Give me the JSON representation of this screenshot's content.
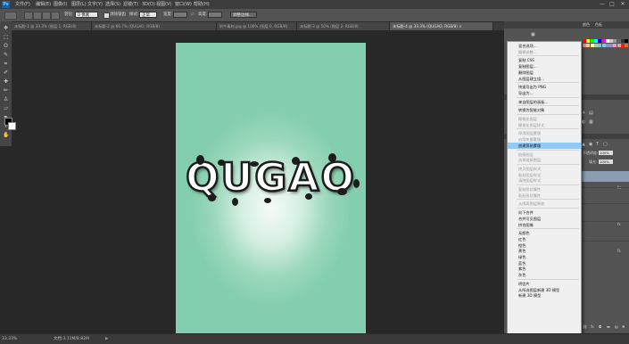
{
  "app": {
    "logo": "Ps"
  },
  "menubar": {
    "items": [
      "文件(F)",
      "编辑(E)",
      "图像(I)",
      "图层(L)",
      "文字(Y)",
      "选择(S)",
      "滤镜(T)",
      "3D(D)",
      "视图(V)",
      "窗口(W)",
      "帮助(H)"
    ],
    "window_controls": [
      "—",
      "□",
      "✕"
    ]
  },
  "options_bar": {
    "feather_label": "羽化:",
    "feather_value": "0 像素",
    "antialias_label": "消除锯齿",
    "style_label": "样式:",
    "style_value": "正常",
    "width_label": "宽度:",
    "height_label": "高度:",
    "refine_button": "调整边缘..."
  },
  "document_tabs": [
    "未标题-1 @ 33.3% (图层 1, RGB/8)",
    "未标题-2 @ 66.7% (QUGAO, RGB/8)",
    "奶牛素材.jpg @ 100% (图层 0, RGB/8)",
    "未标题-3 @ 50% (图层 2, RGB/8)",
    "未标题-4 @ 33.3% (QUGAO, RGB/8) ×"
  ],
  "canvas": {
    "art_text": "QUGAO",
    "background_colors": [
      "#83ceae",
      "#f6fbf8"
    ]
  },
  "statusbar": {
    "zoom": "33.33%",
    "doc_info": "文档:3.11M/8.82M"
  },
  "right_panel": {
    "tabs": [
      "颜色",
      "色板"
    ],
    "swatch_colors": [
      "#ff0000",
      "#ffff00",
      "#00ff00",
      "#00ffff",
      "#0000ff",
      "#ff00ff",
      "#ffffff",
      "#cccccc",
      "#999999",
      "#666666",
      "#333333",
      "#000000",
      "#f7977a",
      "#fdc68a",
      "#fff79a",
      "#a3d39c",
      "#7accc8",
      "#6dcff6",
      "#8393ca",
      "#a187be",
      "#f49ac2",
      "#c7b299",
      "#ed1c24",
      "#f26522"
    ],
    "opacity_label": "不透明度:",
    "opacity_value": "100%",
    "fill_label": "填充:",
    "fill_value": "100%"
  },
  "context_menu": {
    "items": [
      {
        "label": "混合选项...",
        "disabled": false
      },
      {
        "label": "编辑调整...",
        "disabled": true
      },
      {
        "sep": true
      },
      {
        "label": "复制 CSS",
        "disabled": false
      },
      {
        "label": "复制图层...",
        "disabled": false
      },
      {
        "label": "删除图层",
        "disabled": false
      },
      {
        "label": "从图层建立组...",
        "disabled": false
      },
      {
        "sep": true
      },
      {
        "label": "快速导出为 PNG",
        "disabled": false
      },
      {
        "label": "导出为...",
        "disabled": false
      },
      {
        "sep": true
      },
      {
        "label": "来自图层的画板...",
        "disabled": false
      },
      {
        "sep": true
      },
      {
        "label": "转换为智能对象",
        "disabled": false
      },
      {
        "sep": true
      },
      {
        "label": "栅格化图层",
        "disabled": true
      },
      {
        "label": "栅格化图层样式",
        "disabled": true
      },
      {
        "sep": true
      },
      {
        "label": "停用图层蒙版",
        "disabled": true
      },
      {
        "label": "启用矢量蒙版",
        "disabled": true
      },
      {
        "label": "创建剪贴蒙版",
        "disabled": false,
        "highlighted": true
      },
      {
        "sep": true
      },
      {
        "label": "链接图层",
        "disabled": true
      },
      {
        "label": "选择链接图层",
        "disabled": true
      },
      {
        "sep": true
      },
      {
        "label": "拷贝图层样式",
        "disabled": true
      },
      {
        "label": "粘贴图层样式",
        "disabled": true
      },
      {
        "label": "清除图层样式",
        "disabled": true
      },
      {
        "sep": true
      },
      {
        "label": "复制形状属性",
        "disabled": true
      },
      {
        "label": "粘贴形状属性",
        "disabled": true
      },
      {
        "sep": true
      },
      {
        "label": "从隔离图层释放",
        "disabled": true
      },
      {
        "sep": true
      },
      {
        "label": "向下合并",
        "disabled": false
      },
      {
        "label": "合并可见图层",
        "disabled": false
      },
      {
        "label": "拼合图像",
        "disabled": false
      },
      {
        "sep": true
      },
      {
        "label": "无颜色",
        "disabled": false
      },
      {
        "label": "红色",
        "disabled": false
      },
      {
        "label": "橙色",
        "disabled": false
      },
      {
        "label": "黄色",
        "disabled": false
      },
      {
        "label": "绿色",
        "disabled": false
      },
      {
        "label": "蓝色",
        "disabled": false
      },
      {
        "label": "紫色",
        "disabled": false
      },
      {
        "label": "灰色",
        "disabled": false
      },
      {
        "sep": true
      },
      {
        "label": "明信片",
        "disabled": false
      },
      {
        "label": "从所选图层新建 3D 模型",
        "disabled": false
      },
      {
        "label": "新建 3D 模型",
        "disabled": false
      }
    ]
  }
}
